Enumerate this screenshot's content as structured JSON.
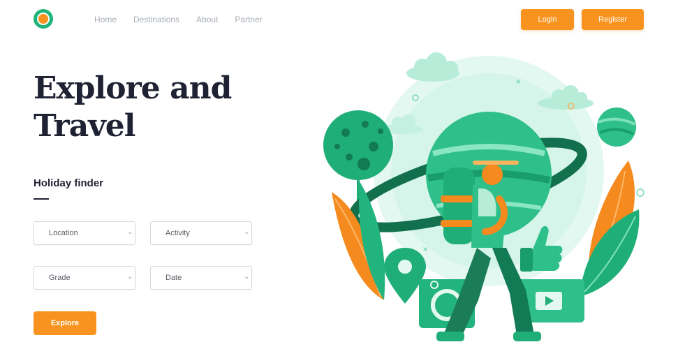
{
  "nav": {
    "items": [
      "Home",
      "Destinations",
      "About",
      "Partner"
    ]
  },
  "auth": {
    "login_label": "Login",
    "register_label": "Register"
  },
  "hero": {
    "title_line1": "Explore and",
    "title_line2": "Travel"
  },
  "finder": {
    "heading": "Holiday finder",
    "fields": {
      "location": "Location",
      "activity": "Activity",
      "grade": "Grade",
      "date": "Date"
    },
    "explore_label": "Explore"
  },
  "colors": {
    "accent": "#f7931e",
    "brand_green": "#1fb47a",
    "heading": "#1f2233",
    "nav_text": "#a7adb4"
  },
  "icons": {
    "logo": "circle-logo-icon",
    "select_chevron": "chevron-down-icon"
  }
}
